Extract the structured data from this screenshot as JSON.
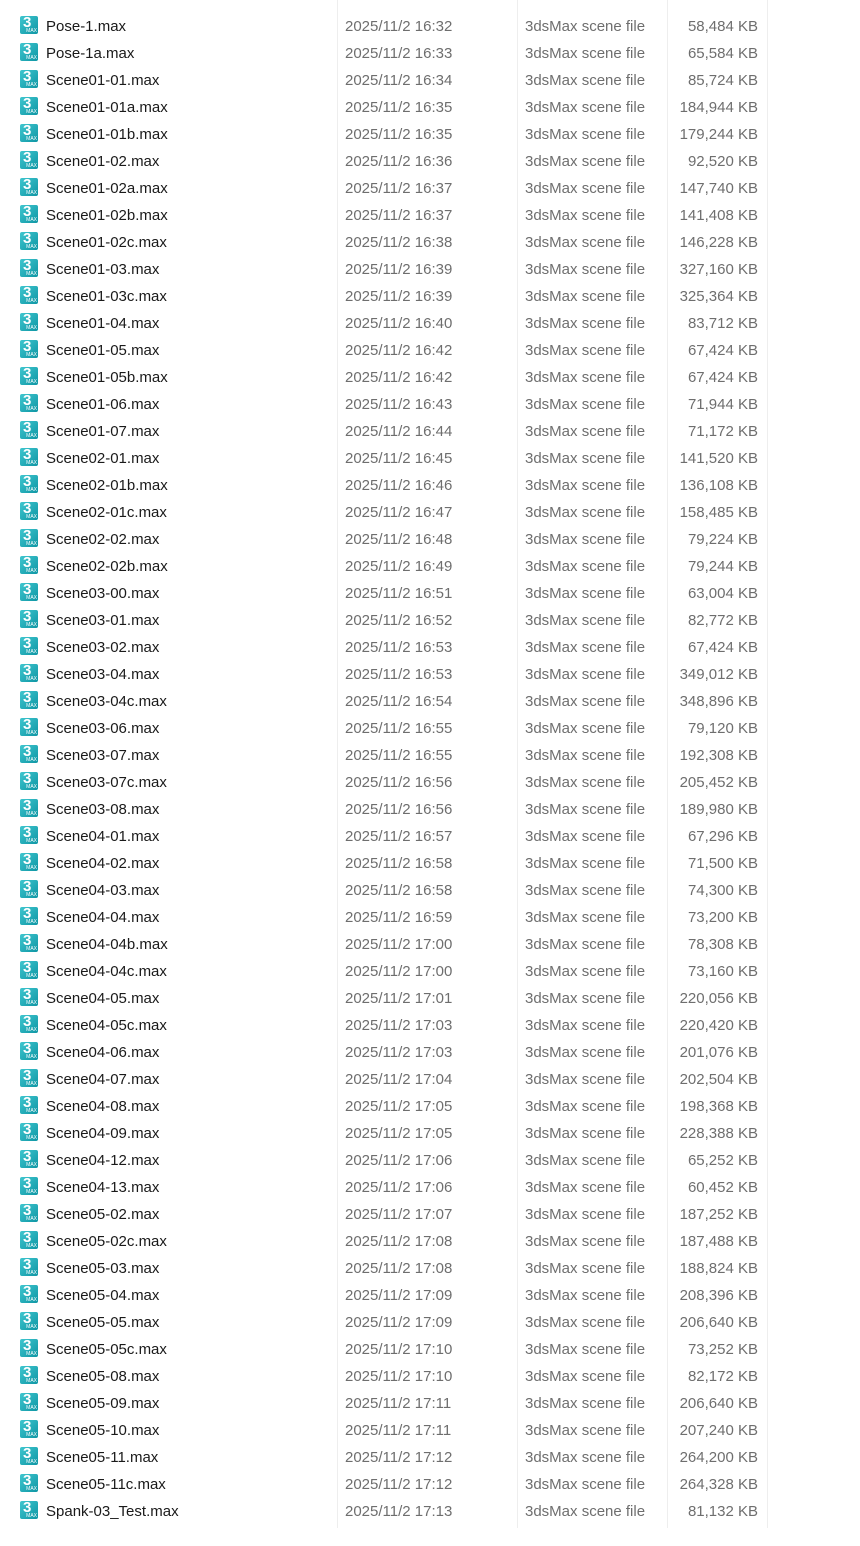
{
  "file_type_icon": {
    "glyph": "3",
    "sub": "MAX",
    "color": "#1aa7b3"
  },
  "files": [
    {
      "name": "Pose-1.max",
      "date": "2025/11/2 16:32",
      "type": "3dsMax scene file",
      "size": "58,484 KB"
    },
    {
      "name": "Pose-1a.max",
      "date": "2025/11/2 16:33",
      "type": "3dsMax scene file",
      "size": "65,584 KB"
    },
    {
      "name": "Scene01-01.max",
      "date": "2025/11/2 16:34",
      "type": "3dsMax scene file",
      "size": "85,724 KB"
    },
    {
      "name": "Scene01-01a.max",
      "date": "2025/11/2 16:35",
      "type": "3dsMax scene file",
      "size": "184,944 KB"
    },
    {
      "name": "Scene01-01b.max",
      "date": "2025/11/2 16:35",
      "type": "3dsMax scene file",
      "size": "179,244 KB"
    },
    {
      "name": "Scene01-02.max",
      "date": "2025/11/2 16:36",
      "type": "3dsMax scene file",
      "size": "92,520 KB"
    },
    {
      "name": "Scene01-02a.max",
      "date": "2025/11/2 16:37",
      "type": "3dsMax scene file",
      "size": "147,740 KB"
    },
    {
      "name": "Scene01-02b.max",
      "date": "2025/11/2 16:37",
      "type": "3dsMax scene file",
      "size": "141,408 KB"
    },
    {
      "name": "Scene01-02c.max",
      "date": "2025/11/2 16:38",
      "type": "3dsMax scene file",
      "size": "146,228 KB"
    },
    {
      "name": "Scene01-03.max",
      "date": "2025/11/2 16:39",
      "type": "3dsMax scene file",
      "size": "327,160 KB"
    },
    {
      "name": "Scene01-03c.max",
      "date": "2025/11/2 16:39",
      "type": "3dsMax scene file",
      "size": "325,364 KB"
    },
    {
      "name": "Scene01-04.max",
      "date": "2025/11/2 16:40",
      "type": "3dsMax scene file",
      "size": "83,712 KB"
    },
    {
      "name": "Scene01-05.max",
      "date": "2025/11/2 16:42",
      "type": "3dsMax scene file",
      "size": "67,424 KB"
    },
    {
      "name": "Scene01-05b.max",
      "date": "2025/11/2 16:42",
      "type": "3dsMax scene file",
      "size": "67,424 KB"
    },
    {
      "name": "Scene01-06.max",
      "date": "2025/11/2 16:43",
      "type": "3dsMax scene file",
      "size": "71,944 KB"
    },
    {
      "name": "Scene01-07.max",
      "date": "2025/11/2 16:44",
      "type": "3dsMax scene file",
      "size": "71,172 KB"
    },
    {
      "name": "Scene02-01.max",
      "date": "2025/11/2 16:45",
      "type": "3dsMax scene file",
      "size": "141,520 KB"
    },
    {
      "name": "Scene02-01b.max",
      "date": "2025/11/2 16:46",
      "type": "3dsMax scene file",
      "size": "136,108 KB"
    },
    {
      "name": "Scene02-01c.max",
      "date": "2025/11/2 16:47",
      "type": "3dsMax scene file",
      "size": "158,485 KB"
    },
    {
      "name": "Scene02-02.max",
      "date": "2025/11/2 16:48",
      "type": "3dsMax scene file",
      "size": "79,224 KB"
    },
    {
      "name": "Scene02-02b.max",
      "date": "2025/11/2 16:49",
      "type": "3dsMax scene file",
      "size": "79,244 KB"
    },
    {
      "name": "Scene03-00.max",
      "date": "2025/11/2 16:51",
      "type": "3dsMax scene file",
      "size": "63,004 KB"
    },
    {
      "name": "Scene03-01.max",
      "date": "2025/11/2 16:52",
      "type": "3dsMax scene file",
      "size": "82,772 KB"
    },
    {
      "name": "Scene03-02.max",
      "date": "2025/11/2 16:53",
      "type": "3dsMax scene file",
      "size": "67,424 KB"
    },
    {
      "name": "Scene03-04.max",
      "date": "2025/11/2 16:53",
      "type": "3dsMax scene file",
      "size": "349,012 KB"
    },
    {
      "name": "Scene03-04c.max",
      "date": "2025/11/2 16:54",
      "type": "3dsMax scene file",
      "size": "348,896 KB"
    },
    {
      "name": "Scene03-06.max",
      "date": "2025/11/2 16:55",
      "type": "3dsMax scene file",
      "size": "79,120 KB"
    },
    {
      "name": "Scene03-07.max",
      "date": "2025/11/2 16:55",
      "type": "3dsMax scene file",
      "size": "192,308 KB"
    },
    {
      "name": "Scene03-07c.max",
      "date": "2025/11/2 16:56",
      "type": "3dsMax scene file",
      "size": "205,452 KB"
    },
    {
      "name": "Scene03-08.max",
      "date": "2025/11/2 16:56",
      "type": "3dsMax scene file",
      "size": "189,980 KB"
    },
    {
      "name": "Scene04-01.max",
      "date": "2025/11/2 16:57",
      "type": "3dsMax scene file",
      "size": "67,296 KB"
    },
    {
      "name": "Scene04-02.max",
      "date": "2025/11/2 16:58",
      "type": "3dsMax scene file",
      "size": "71,500 KB"
    },
    {
      "name": "Scene04-03.max",
      "date": "2025/11/2 16:58",
      "type": "3dsMax scene file",
      "size": "74,300 KB"
    },
    {
      "name": "Scene04-04.max",
      "date": "2025/11/2 16:59",
      "type": "3dsMax scene file",
      "size": "73,200 KB"
    },
    {
      "name": "Scene04-04b.max",
      "date": "2025/11/2 17:00",
      "type": "3dsMax scene file",
      "size": "78,308 KB"
    },
    {
      "name": "Scene04-04c.max",
      "date": "2025/11/2 17:00",
      "type": "3dsMax scene file",
      "size": "73,160 KB"
    },
    {
      "name": "Scene04-05.max",
      "date": "2025/11/2 17:01",
      "type": "3dsMax scene file",
      "size": "220,056 KB"
    },
    {
      "name": "Scene04-05c.max",
      "date": "2025/11/2 17:03",
      "type": "3dsMax scene file",
      "size": "220,420 KB"
    },
    {
      "name": "Scene04-06.max",
      "date": "2025/11/2 17:03",
      "type": "3dsMax scene file",
      "size": "201,076 KB"
    },
    {
      "name": "Scene04-07.max",
      "date": "2025/11/2 17:04",
      "type": "3dsMax scene file",
      "size": "202,504 KB"
    },
    {
      "name": "Scene04-08.max",
      "date": "2025/11/2 17:05",
      "type": "3dsMax scene file",
      "size": "198,368 KB"
    },
    {
      "name": "Scene04-09.max",
      "date": "2025/11/2 17:05",
      "type": "3dsMax scene file",
      "size": "228,388 KB"
    },
    {
      "name": "Scene04-12.max",
      "date": "2025/11/2 17:06",
      "type": "3dsMax scene file",
      "size": "65,252 KB"
    },
    {
      "name": "Scene04-13.max",
      "date": "2025/11/2 17:06",
      "type": "3dsMax scene file",
      "size": "60,452 KB"
    },
    {
      "name": "Scene05-02.max",
      "date": "2025/11/2 17:07",
      "type": "3dsMax scene file",
      "size": "187,252 KB"
    },
    {
      "name": "Scene05-02c.max",
      "date": "2025/11/2 17:08",
      "type": "3dsMax scene file",
      "size": "187,488 KB"
    },
    {
      "name": "Scene05-03.max",
      "date": "2025/11/2 17:08",
      "type": "3dsMax scene file",
      "size": "188,824 KB"
    },
    {
      "name": "Scene05-04.max",
      "date": "2025/11/2 17:09",
      "type": "3dsMax scene file",
      "size": "208,396 KB"
    },
    {
      "name": "Scene05-05.max",
      "date": "2025/11/2 17:09",
      "type": "3dsMax scene file",
      "size": "206,640 KB"
    },
    {
      "name": "Scene05-05c.max",
      "date": "2025/11/2 17:10",
      "type": "3dsMax scene file",
      "size": "73,252 KB"
    },
    {
      "name": "Scene05-08.max",
      "date": "2025/11/2 17:10",
      "type": "3dsMax scene file",
      "size": "82,172 KB"
    },
    {
      "name": "Scene05-09.max",
      "date": "2025/11/2 17:11",
      "type": "3dsMax scene file",
      "size": "206,640 KB"
    },
    {
      "name": "Scene05-10.max",
      "date": "2025/11/2 17:11",
      "type": "3dsMax scene file",
      "size": "207,240 KB"
    },
    {
      "name": "Scene05-11.max",
      "date": "2025/11/2 17:12",
      "type": "3dsMax scene file",
      "size": "264,200 KB"
    },
    {
      "name": "Scene05-11c.max",
      "date": "2025/11/2 17:12",
      "type": "3dsMax scene file",
      "size": "264,328 KB"
    },
    {
      "name": "Spank-03_Test.max",
      "date": "2025/11/2 17:13",
      "type": "3dsMax scene file",
      "size": "81,132 KB"
    }
  ]
}
